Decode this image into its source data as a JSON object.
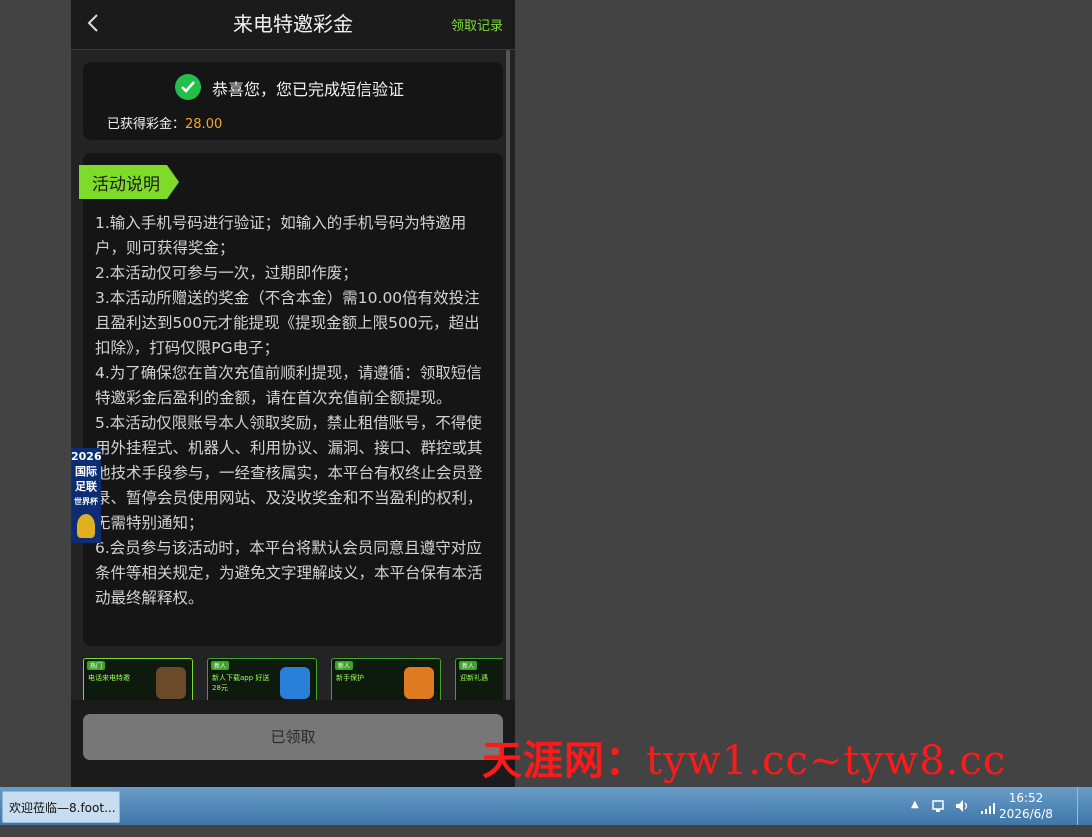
{
  "header": {
    "title": "来电特邀彩金",
    "records_link": "领取记录"
  },
  "status": {
    "message": "恭喜您，您已完成短信验证",
    "bonus_label": "已获得彩金：",
    "bonus_value": "28.00"
  },
  "activity": {
    "tag": "活动说明",
    "rules": [
      "1.输入手机号码进行验证；如输入的手机号码为特邀用户，则可获得奖金；",
      "2.本活动仅可参与一次，过期即作废；",
      "3.本活动所赠送的奖金（不含本金）需10.00倍有效投注且盈利达到500元才能提现《提现金额上限500元，超出扣除》，打码仅限PG电子；",
      "4.为了确保您在首次充值前顺利提现，请遵循：领取短信特邀彩金后盈利的金额，请在首次充值前全额提现。",
      "5.本活动仅限账号本人领取奖励，禁止租借账号，不得使用外挂程式、机器人、利用协议、漏洞、接口、群控或其他技术手段参与，一经查核属实，本平台有权终止会员登录、暂停会员使用网站、及没收奖金和不当盈利的权利，无需特别通知；",
      "6.会员参与该活动时，本平台将默认会员同意且遵守对应条件等相关规定，为避免文字理解歧义，本平台保有本活动最终解释权。"
    ]
  },
  "thumbnails": [
    {
      "tag": "热门",
      "text": "电话来电特邀"
    },
    {
      "tag": "新人",
      "text": "新人下载app 好送28元"
    },
    {
      "tag": "新人",
      "text": "新手保护"
    },
    {
      "tag": "新人",
      "text": "迎新礼遇"
    }
  ],
  "claim_button": "已领取",
  "side_badge": {
    "lines": [
      "2026",
      "国际",
      "足联",
      "世界杯"
    ]
  },
  "watermark": {
    "cn": "天涯网：",
    "en": "tyw1.cc~tyw8.cc"
  },
  "taskbar": {
    "window_title": "欢迎莅临—8.foot...",
    "time": "16:52",
    "date": "2026/6/8"
  },
  "colors": {
    "accent_green": "#7fdb2a",
    "bonus_orange": "#f5a623",
    "check_green": "#22c04a",
    "watermark_red": "#ff1a1a"
  }
}
